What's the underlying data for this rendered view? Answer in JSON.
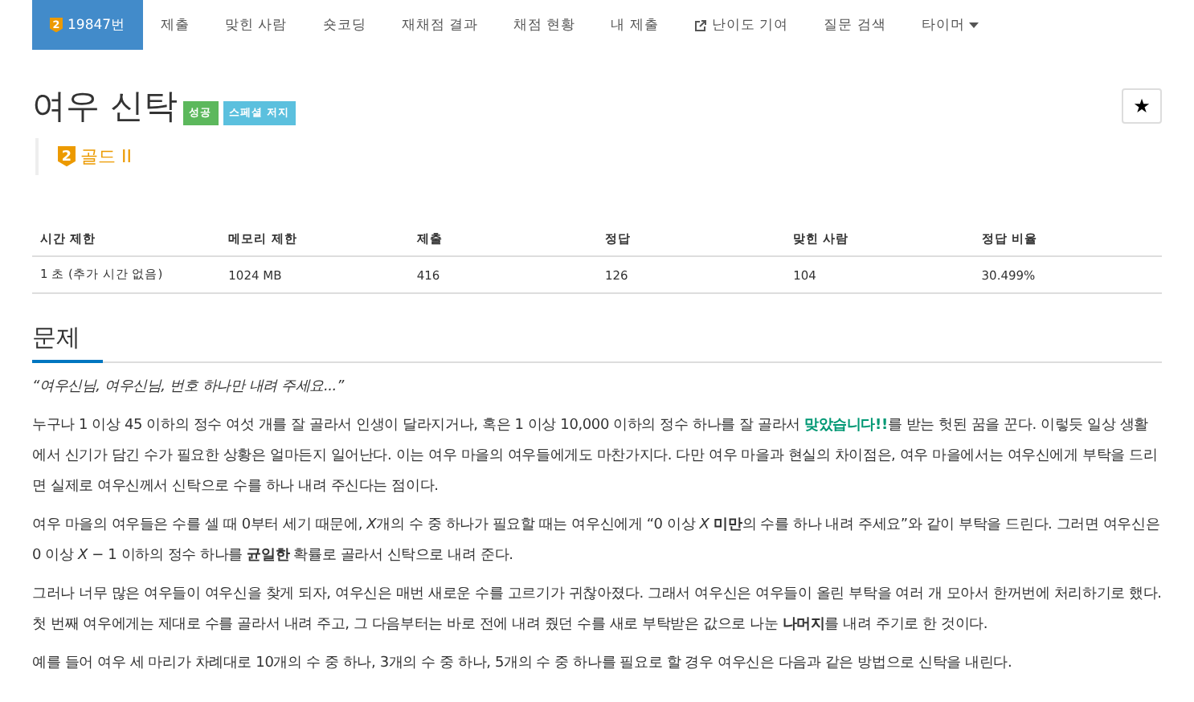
{
  "nav": {
    "items": [
      {
        "label": "19847번",
        "selected": true,
        "kind": "problem",
        "badge": "2"
      },
      {
        "label": "제출",
        "selected": false,
        "kind": "plain"
      },
      {
        "label": "맞힌 사람",
        "selected": false,
        "kind": "plain"
      },
      {
        "label": "숏코딩",
        "selected": false,
        "kind": "plain"
      },
      {
        "label": "재채점 결과",
        "selected": false,
        "kind": "plain"
      },
      {
        "label": "채점 현황",
        "selected": false,
        "kind": "plain"
      },
      {
        "label": "내 제출",
        "selected": false,
        "kind": "plain"
      },
      {
        "label": "난이도 기여",
        "selected": false,
        "kind": "external"
      },
      {
        "label": "질문 검색",
        "selected": false,
        "kind": "plain"
      },
      {
        "label": "타이머",
        "selected": false,
        "kind": "dropdown"
      }
    ]
  },
  "problem": {
    "title": "여우 신탁",
    "labels": [
      {
        "text": "성공",
        "color": "#5cb85c"
      },
      {
        "text": "스페셜 저지",
        "color": "#5bc0de"
      }
    ],
    "star_button": "★",
    "tier": {
      "text": "골드 II",
      "badge": "2"
    }
  },
  "info_table": {
    "columns": [
      "시간 제한",
      "메모리 제한",
      "제출",
      "정답",
      "맞힌 사람",
      "정답 비율"
    ],
    "rows": [
      [
        "1 초 (추가 시간 없음)",
        "1024 MB",
        "416",
        "126",
        "104",
        "30.499%"
      ]
    ]
  },
  "section": {
    "heading": "문제",
    "paragraphs": [
      {
        "kind": "quote",
        "segments": [
          {
            "kind": "plain",
            "text": "“여우신님, 여우신님, 번호 하나만 내려 주세요...”"
          }
        ]
      },
      {
        "kind": "body",
        "segments": [
          {
            "kind": "plain",
            "text": "누구나 1 이상 45 이하의 정수 여섯 개를 잘 골라서 인생이 달라지거나, 혹은 1 이상 10,000 이하의 정수 하나를 잘 골라서 "
          },
          {
            "kind": "verdict",
            "text": "맞았습니다!!"
          },
          {
            "kind": "plain",
            "text": "를 받는 헛된 꿈을 꾼다. 이렇듯 일상 생활에서 신기가 담긴 수가 필요한 상황은 얼마든지 일어난다. 이는 여우 마을의 여우들에게도 마찬가지다. 다만 여우 마을과 현실의 차이점은, 여우 마을에서는 여우신에게 부탁을 드리면 실제로 여우신께서 신탁으로 수를 하나 내려 주신다는 점이다."
          }
        ]
      },
      {
        "kind": "body",
        "segments": [
          {
            "kind": "plain",
            "text": "여우 마을의 여우들은 수를 셀 때 0부터 세기 때문에, "
          },
          {
            "kind": "math",
            "text": "X"
          },
          {
            "kind": "plain",
            "text": "개의 수 중 하나가 필요할 때는 여우신에게 “0 이상 "
          },
          {
            "kind": "math",
            "text": "X"
          },
          {
            "kind": "bold",
            "text": " 미만"
          },
          {
            "kind": "plain",
            "text": "의 수를 하나 내려 주세요”와 같이 부탁을 드린다. 그러면 여우신은 0 이상 "
          },
          {
            "kind": "math",
            "text": "X"
          },
          {
            "kind": "plain",
            "text": " − 1 이하의 정수 하나를 "
          },
          {
            "kind": "bold",
            "text": "균일한"
          },
          {
            "kind": "plain",
            "text": " 확률로 골라서 신탁으로 내려 준다."
          }
        ]
      },
      {
        "kind": "body",
        "segments": [
          {
            "kind": "plain",
            "text": "그러나 너무 많은 여우들이 여우신을 찾게 되자, 여우신은 매번 새로운 수를 고르기가 귀찮아졌다. 그래서 여우신은 여우들이 올린 부탁을 여러 개 모아서 한꺼번에 처리하기로 했다. 첫 번째 여우에게는 제대로 수를 골라서 내려 주고, 그 다음부터는 바로 전에 내려 줬던 수를 새로 부탁받은 값으로 나눈 "
          },
          {
            "kind": "bold",
            "text": "나머지"
          },
          {
            "kind": "plain",
            "text": "를 내려 주기로 한 것이다."
          }
        ]
      },
      {
        "kind": "body",
        "segments": [
          {
            "kind": "plain",
            "text": "예를 들어 여우 세 마리가 차례대로 10개의 수 중 하나, 3개의 수 중 하나, 5개의 수 중 하나를 필요로 할 경우 여우신은 다음과 같은 방법으로 신탁을 내린다."
          }
        ]
      }
    ]
  }
}
